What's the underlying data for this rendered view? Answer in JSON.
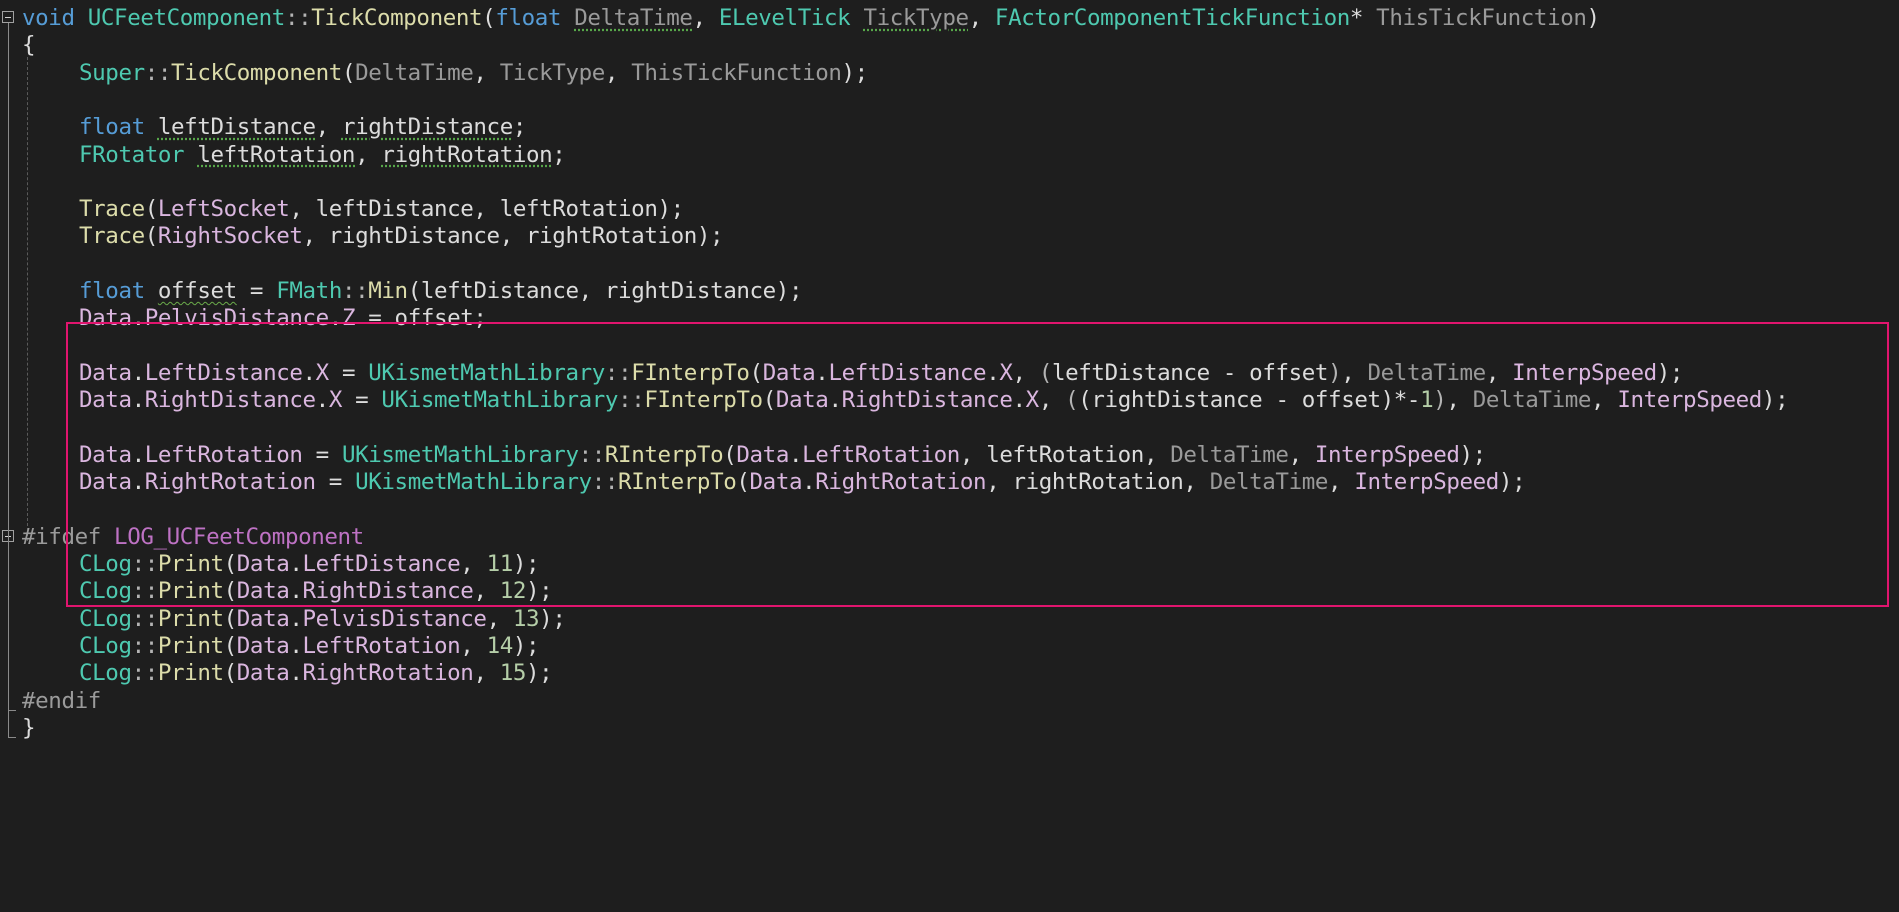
{
  "colors": {
    "background": "#1e1e1e",
    "keyword": "#569cd6",
    "type": "#4ec9b0",
    "function": "#dcdcaa",
    "parameter": "#9a9a9a",
    "member": "#dab6df",
    "macro": "#be72c4",
    "number": "#b5cea8",
    "highlight_border": "#e0156e"
  },
  "lines": [
    {
      "indent": 0,
      "fold": "start",
      "tokens": [
        {
          "t": "void",
          "c": "kw"
        },
        {
          "t": " ",
          "c": "default"
        },
        {
          "t": "UCFeetComponent",
          "c": "type"
        },
        {
          "t": "::",
          "c": "op"
        },
        {
          "t": "TickComponent",
          "c": "fn"
        },
        {
          "t": "(",
          "c": "default"
        },
        {
          "t": "float",
          "c": "kw"
        },
        {
          "t": " ",
          "c": "default"
        },
        {
          "t": "DeltaTime",
          "c": "param",
          "sq": "dots"
        },
        {
          "t": ", ",
          "c": "default"
        },
        {
          "t": "ELevelTick",
          "c": "type"
        },
        {
          "t": " ",
          "c": "default"
        },
        {
          "t": "TickType",
          "c": "param",
          "sq": "dots"
        },
        {
          "t": ", ",
          "c": "default"
        },
        {
          "t": "FActorComponentTickFunction",
          "c": "type"
        },
        {
          "t": "* ",
          "c": "default"
        },
        {
          "t": "ThisTickFunction",
          "c": "param"
        },
        {
          "t": ")",
          "c": "default"
        }
      ]
    },
    {
      "indent": 0,
      "tokens": [
        {
          "t": "{",
          "c": "default"
        }
      ]
    },
    {
      "indent": 1,
      "tokens": [
        {
          "t": "Super",
          "c": "type"
        },
        {
          "t": "::",
          "c": "op"
        },
        {
          "t": "TickComponent",
          "c": "fn"
        },
        {
          "t": "(",
          "c": "default"
        },
        {
          "t": "DeltaTime",
          "c": "param"
        },
        {
          "t": ", ",
          "c": "default"
        },
        {
          "t": "TickType",
          "c": "param"
        },
        {
          "t": ", ",
          "c": "default"
        },
        {
          "t": "ThisTickFunction",
          "c": "param"
        },
        {
          "t": ");",
          "c": "default"
        }
      ]
    },
    {
      "indent": 1,
      "tokens": []
    },
    {
      "indent": 1,
      "tokens": [
        {
          "t": "float",
          "c": "kw"
        },
        {
          "t": " ",
          "c": "default"
        },
        {
          "t": "leftDistance",
          "c": "local",
          "sq": "dots"
        },
        {
          "t": ", ",
          "c": "default"
        },
        {
          "t": "rightDistance",
          "c": "local",
          "sq": "dots"
        },
        {
          "t": ";",
          "c": "default"
        }
      ]
    },
    {
      "indent": 1,
      "tokens": [
        {
          "t": "FRotator",
          "c": "type"
        },
        {
          "t": " ",
          "c": "default"
        },
        {
          "t": "leftRotation",
          "c": "local",
          "sq": "dots"
        },
        {
          "t": ", ",
          "c": "default"
        },
        {
          "t": "rightRotation",
          "c": "local",
          "sq": "dots"
        },
        {
          "t": ";",
          "c": "default"
        }
      ]
    },
    {
      "indent": 1,
      "tokens": []
    },
    {
      "indent": 1,
      "tokens": [
        {
          "t": "Trace",
          "c": "fn"
        },
        {
          "t": "(",
          "c": "default"
        },
        {
          "t": "LeftSocket",
          "c": "member"
        },
        {
          "t": ", ",
          "c": "default"
        },
        {
          "t": "leftDistance",
          "c": "local"
        },
        {
          "t": ", ",
          "c": "default"
        },
        {
          "t": "leftRotation",
          "c": "local"
        },
        {
          "t": ");",
          "c": "default"
        }
      ]
    },
    {
      "indent": 1,
      "tokens": [
        {
          "t": "Trace",
          "c": "fn"
        },
        {
          "t": "(",
          "c": "default"
        },
        {
          "t": "RightSocket",
          "c": "member"
        },
        {
          "t": ", ",
          "c": "default"
        },
        {
          "t": "rightDistance",
          "c": "local"
        },
        {
          "t": ", ",
          "c": "default"
        },
        {
          "t": "rightRotation",
          "c": "local"
        },
        {
          "t": ");",
          "c": "default"
        }
      ]
    },
    {
      "indent": 1,
      "tokens": []
    },
    {
      "indent": 1,
      "tokens": [
        {
          "t": "float",
          "c": "kw"
        },
        {
          "t": " ",
          "c": "default"
        },
        {
          "t": "offset",
          "c": "local",
          "sq": "wave"
        },
        {
          "t": " = ",
          "c": "default"
        },
        {
          "t": "FMath",
          "c": "type"
        },
        {
          "t": "::",
          "c": "op"
        },
        {
          "t": "Min",
          "c": "fn"
        },
        {
          "t": "(leftDistance, rightDistance);",
          "c": "default"
        }
      ]
    },
    {
      "indent": 1,
      "tokens": [
        {
          "t": "Data",
          "c": "member"
        },
        {
          "t": ".",
          "c": "default"
        },
        {
          "t": "PelvisDistance",
          "c": "member"
        },
        {
          "t": ".",
          "c": "default"
        },
        {
          "t": "Z",
          "c": "member"
        },
        {
          "t": " = offset;",
          "c": "default"
        }
      ]
    },
    {
      "indent": 1,
      "tokens": []
    },
    {
      "indent": 1,
      "tokens": [
        {
          "t": "Data",
          "c": "member"
        },
        {
          "t": ".",
          "c": "default"
        },
        {
          "t": "LeftDistance",
          "c": "member"
        },
        {
          "t": ".",
          "c": "default"
        },
        {
          "t": "X",
          "c": "member"
        },
        {
          "t": " = ",
          "c": "default"
        },
        {
          "t": "UKismetMathLibrary",
          "c": "type"
        },
        {
          "t": "::",
          "c": "op"
        },
        {
          "t": "FInterpTo",
          "c": "fn"
        },
        {
          "t": "(",
          "c": "default"
        },
        {
          "t": "Data",
          "c": "member"
        },
        {
          "t": ".",
          "c": "default"
        },
        {
          "t": "LeftDistance",
          "c": "member"
        },
        {
          "t": ".",
          "c": "default"
        },
        {
          "t": "X",
          "c": "member"
        },
        {
          "t": ", ",
          "c": "default"
        },
        {
          "t": "(",
          "c": "op"
        },
        {
          "t": "leftDistance - offset",
          "c": "default"
        },
        {
          "t": ")",
          "c": "op"
        },
        {
          "t": ", ",
          "c": "default"
        },
        {
          "t": "DeltaTime",
          "c": "param"
        },
        {
          "t": ", ",
          "c": "default"
        },
        {
          "t": "InterpSpeed",
          "c": "member"
        },
        {
          "t": ");",
          "c": "default"
        }
      ]
    },
    {
      "indent": 1,
      "tokens": [
        {
          "t": "Data",
          "c": "member"
        },
        {
          "t": ".",
          "c": "default"
        },
        {
          "t": "RightDistance",
          "c": "member"
        },
        {
          "t": ".",
          "c": "default"
        },
        {
          "t": "X",
          "c": "member"
        },
        {
          "t": " = ",
          "c": "default"
        },
        {
          "t": "UKismetMathLibrary",
          "c": "type"
        },
        {
          "t": "::",
          "c": "op"
        },
        {
          "t": "FInterpTo",
          "c": "fn"
        },
        {
          "t": "(",
          "c": "default"
        },
        {
          "t": "Data",
          "c": "member"
        },
        {
          "t": ".",
          "c": "default"
        },
        {
          "t": "RightDistance",
          "c": "member"
        },
        {
          "t": ".",
          "c": "default"
        },
        {
          "t": "X",
          "c": "member"
        },
        {
          "t": ", ",
          "c": "default"
        },
        {
          "t": "(",
          "c": "op"
        },
        {
          "t": "(rightDistance - offset)*-",
          "c": "default"
        },
        {
          "t": "1",
          "c": "num"
        },
        {
          "t": ")",
          "c": "op"
        },
        {
          "t": ", ",
          "c": "default"
        },
        {
          "t": "DeltaTime",
          "c": "param"
        },
        {
          "t": ", ",
          "c": "default"
        },
        {
          "t": "InterpSpeed",
          "c": "member"
        },
        {
          "t": ");",
          "c": "default"
        }
      ]
    },
    {
      "indent": 1,
      "tokens": []
    },
    {
      "indent": 1,
      "tokens": [
        {
          "t": "Data",
          "c": "member"
        },
        {
          "t": ".",
          "c": "default"
        },
        {
          "t": "LeftRotation",
          "c": "member"
        },
        {
          "t": " = ",
          "c": "default"
        },
        {
          "t": "UKismetMathLibrary",
          "c": "type"
        },
        {
          "t": "::",
          "c": "op"
        },
        {
          "t": "RInterpTo",
          "c": "fn"
        },
        {
          "t": "(",
          "c": "default"
        },
        {
          "t": "Data",
          "c": "member"
        },
        {
          "t": ".",
          "c": "default"
        },
        {
          "t": "LeftRotation",
          "c": "member"
        },
        {
          "t": ", leftRotation, ",
          "c": "default"
        },
        {
          "t": "DeltaTime",
          "c": "param"
        },
        {
          "t": ", ",
          "c": "default"
        },
        {
          "t": "InterpSpeed",
          "c": "member"
        },
        {
          "t": ");",
          "c": "default"
        }
      ]
    },
    {
      "indent": 1,
      "tokens": [
        {
          "t": "Data",
          "c": "member"
        },
        {
          "t": ".",
          "c": "default"
        },
        {
          "t": "RightRotation",
          "c": "member"
        },
        {
          "t": " = ",
          "c": "default"
        },
        {
          "t": "UKismetMathLibrary",
          "c": "type"
        },
        {
          "t": "::",
          "c": "op"
        },
        {
          "t": "RInterpTo",
          "c": "fn"
        },
        {
          "t": "(",
          "c": "default"
        },
        {
          "t": "Data",
          "c": "member"
        },
        {
          "t": ".",
          "c": "default"
        },
        {
          "t": "RightRotation",
          "c": "member"
        },
        {
          "t": ", rightRotation, ",
          "c": "default"
        },
        {
          "t": "DeltaTime",
          "c": "param"
        },
        {
          "t": ", ",
          "c": "default"
        },
        {
          "t": "InterpSpeed",
          "c": "member"
        },
        {
          "t": ");",
          "c": "default"
        }
      ]
    },
    {
      "indent": 1,
      "tokens": []
    },
    {
      "indent": 0,
      "fold": "start",
      "tokens": [
        {
          "t": "#ifdef",
          "c": "pre"
        },
        {
          "t": " ",
          "c": "default"
        },
        {
          "t": "LOG_UCFeetComponent",
          "c": "macro"
        }
      ]
    },
    {
      "indent": 1,
      "tokens": [
        {
          "t": "CLog",
          "c": "type"
        },
        {
          "t": "::",
          "c": "op"
        },
        {
          "t": "Print",
          "c": "fn"
        },
        {
          "t": "(",
          "c": "default"
        },
        {
          "t": "Data",
          "c": "member"
        },
        {
          "t": ".",
          "c": "default"
        },
        {
          "t": "LeftDistance",
          "c": "member"
        },
        {
          "t": ", ",
          "c": "default"
        },
        {
          "t": "11",
          "c": "num"
        },
        {
          "t": ");",
          "c": "default"
        }
      ]
    },
    {
      "indent": 1,
      "tokens": [
        {
          "t": "CLog",
          "c": "type"
        },
        {
          "t": "::",
          "c": "op"
        },
        {
          "t": "Print",
          "c": "fn"
        },
        {
          "t": "(",
          "c": "default"
        },
        {
          "t": "Data",
          "c": "member"
        },
        {
          "t": ".",
          "c": "default"
        },
        {
          "t": "RightDistance",
          "c": "member"
        },
        {
          "t": ", ",
          "c": "default"
        },
        {
          "t": "12",
          "c": "num"
        },
        {
          "t": ");",
          "c": "default"
        }
      ]
    },
    {
      "indent": 1,
      "tokens": [
        {
          "t": "CLog",
          "c": "type"
        },
        {
          "t": "::",
          "c": "op"
        },
        {
          "t": "Print",
          "c": "fn"
        },
        {
          "t": "(",
          "c": "default"
        },
        {
          "t": "Data",
          "c": "member"
        },
        {
          "t": ".",
          "c": "default"
        },
        {
          "t": "PelvisDistance",
          "c": "member"
        },
        {
          "t": ", ",
          "c": "default"
        },
        {
          "t": "13",
          "c": "num"
        },
        {
          "t": ");",
          "c": "default"
        }
      ]
    },
    {
      "indent": 1,
      "tokens": [
        {
          "t": "CLog",
          "c": "type"
        },
        {
          "t": "::",
          "c": "op"
        },
        {
          "t": "Print",
          "c": "fn"
        },
        {
          "t": "(",
          "c": "default"
        },
        {
          "t": "Data",
          "c": "member"
        },
        {
          "t": ".",
          "c": "default"
        },
        {
          "t": "LeftRotation",
          "c": "member"
        },
        {
          "t": ", ",
          "c": "default"
        },
        {
          "t": "14",
          "c": "num"
        },
        {
          "t": ");",
          "c": "default"
        }
      ]
    },
    {
      "indent": 1,
      "tokens": [
        {
          "t": "CLog",
          "c": "type"
        },
        {
          "t": "::",
          "c": "op"
        },
        {
          "t": "Print",
          "c": "fn"
        },
        {
          "t": "(",
          "c": "default"
        },
        {
          "t": "Data",
          "c": "member"
        },
        {
          "t": ".",
          "c": "default"
        },
        {
          "t": "RightRotation",
          "c": "member"
        },
        {
          "t": ", ",
          "c": "default"
        },
        {
          "t": "15",
          "c": "num"
        },
        {
          "t": ");",
          "c": "default"
        }
      ]
    },
    {
      "indent": 0,
      "fold": "end",
      "tokens": [
        {
          "t": "#endif",
          "c": "pre"
        }
      ]
    },
    {
      "indent": 0,
      "fold": "end",
      "tokens": [
        {
          "t": "}",
          "c": "default"
        }
      ]
    }
  ]
}
